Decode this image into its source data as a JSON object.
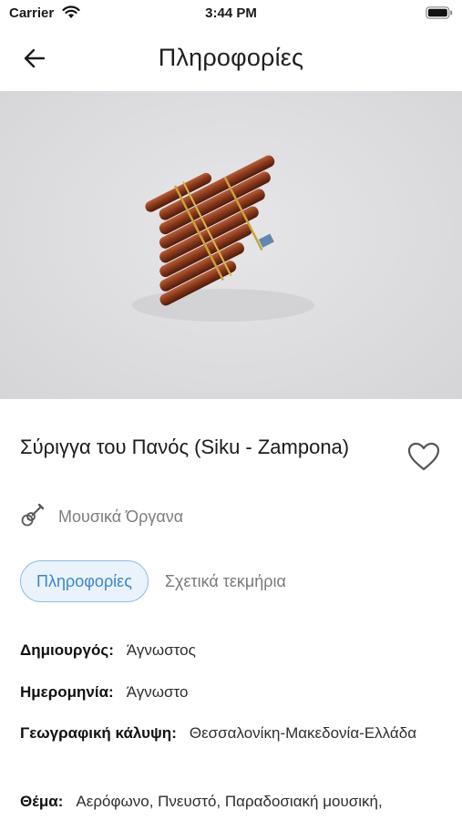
{
  "status_bar": {
    "carrier": "Carrier",
    "time": "3:44 PM"
  },
  "header": {
    "title": "Πληροφορίες"
  },
  "item": {
    "title": "Σύριγγα του Πανός (Siku - Zampona)",
    "category": "Μουσικά Όργανα"
  },
  "tabs": [
    {
      "label": "Πληροφορίες",
      "active": true
    },
    {
      "label": "Σχετικά τεκμήρια",
      "active": false
    }
  ],
  "fields": [
    {
      "label": "Δημιουργός:",
      "value": "Άγνωστος"
    },
    {
      "label": "Ημερομηνία:",
      "value": "Άγνωστο"
    },
    {
      "label": "Γεωγραφική κάλυψη:",
      "value": "Θεσσαλονίκη-Μακεδονία-Ελλάδα"
    },
    {
      "label": "Θέμα:",
      "value": "Αερόφωνο, Πνευστό, Παραδοσιακή μουσική,"
    }
  ],
  "colors": {
    "accent": "#3a86cc",
    "tab_bg": "#eaf3fb",
    "hero_bg": "#dcdcdf"
  },
  "icons": {
    "back": "arrow-left-icon",
    "favorite": "heart-outline-icon",
    "category": "guitar-icon"
  }
}
